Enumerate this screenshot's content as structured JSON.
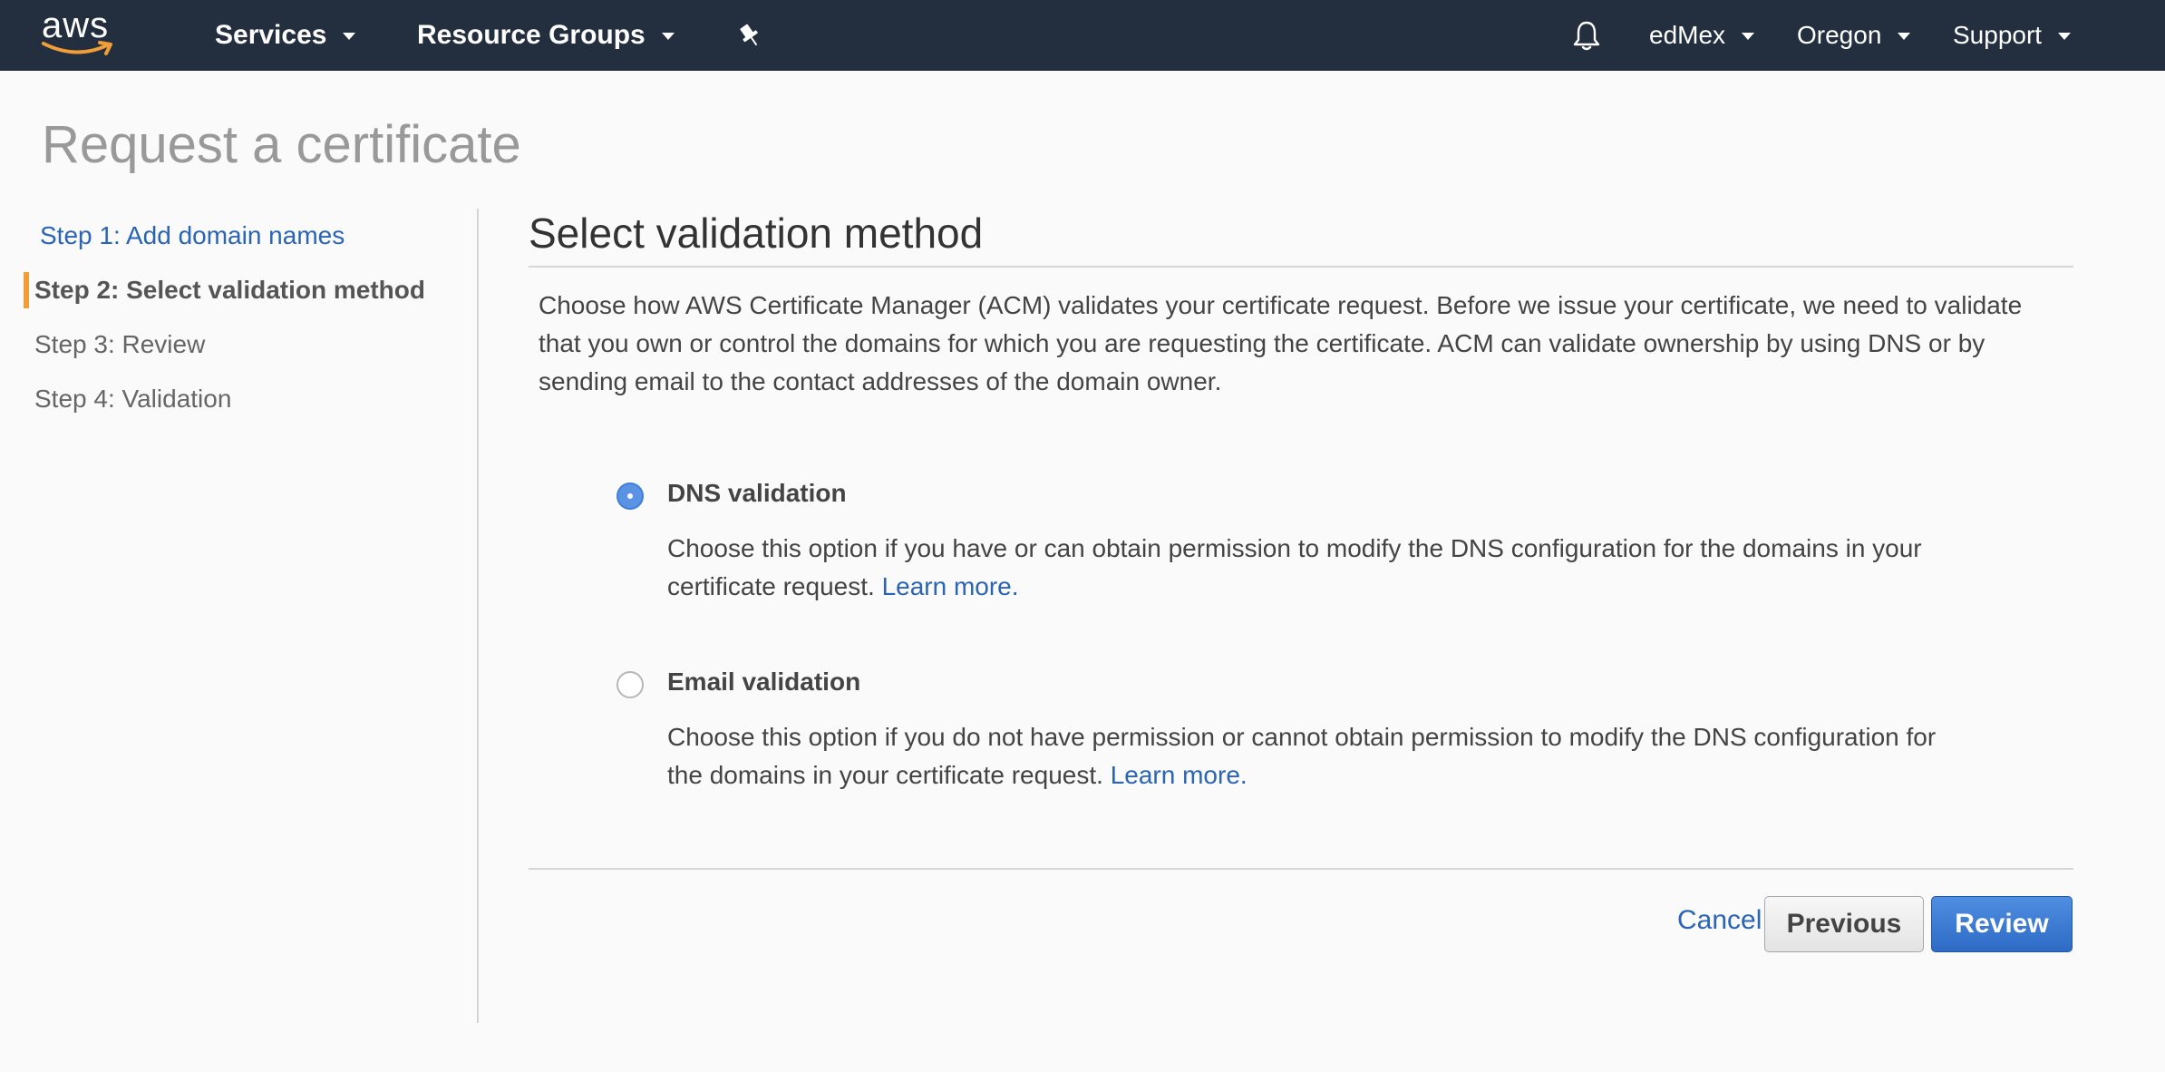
{
  "topbar": {
    "logo_text": "aws",
    "services_label": "Services",
    "resource_groups_label": "Resource Groups",
    "user_label": "edMex",
    "region_label": "Oregon",
    "support_label": "Support",
    "icons": [
      "pin-icon",
      "bell-icon",
      "chevron-down-icon"
    ]
  },
  "page": {
    "title": "Request a certificate"
  },
  "sidebar": {
    "steps": [
      {
        "label": "Step 1: Add domain names",
        "state": "link"
      },
      {
        "label": "Step 2: Select validation method",
        "state": "active"
      },
      {
        "label": "Step 3: Review",
        "state": "pending"
      },
      {
        "label": "Step 4: Validation",
        "state": "pending"
      }
    ]
  },
  "main": {
    "section_title": "Select validation method",
    "intro": "Choose how AWS Certificate Manager (ACM) validates your certificate request. Before we issue your certificate, we need to validate that you own or control the domains for which you are requesting the certificate. ACM can validate ownership by using DNS or by sending email to the contact addresses of the domain owner.",
    "options": [
      {
        "title": "DNS validation",
        "description": "Choose this option if you have or can obtain permission to modify the DNS configuration for the domains in your certificate request.",
        "link": "Learn more.",
        "selected": true
      },
      {
        "title": "Email validation",
        "description": "Choose this option if you do not have permission or cannot obtain permission to modify the DNS configuration for the domains in your certificate request.",
        "link": "Learn more.",
        "selected": false
      }
    ]
  },
  "footer": {
    "cancel_label": "Cancel",
    "previous_label": "Previous",
    "review_label": "Review"
  },
  "colors": {
    "topbar": "#232f3e",
    "accent_orange": "#f19e38",
    "link_blue": "#2a64b5",
    "primary_button": "#3a7bd5"
  }
}
